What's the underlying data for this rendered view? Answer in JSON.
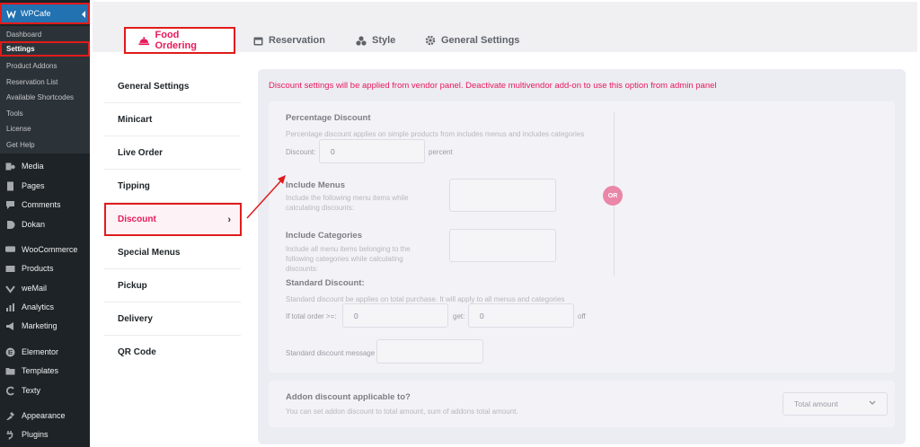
{
  "sidebar": {
    "top_item": {
      "label": "WPCafe",
      "icon": "wpcafe-logo-icon"
    },
    "submenu": [
      "Dashboard",
      "Settings",
      "Product Addons",
      "Reservation List",
      "Available Shortcodes",
      "Tools",
      "License",
      "Get Help"
    ],
    "active_submenu": "Settings",
    "menu": [
      {
        "label": "Media",
        "icon": "media-icon"
      },
      {
        "label": "Pages",
        "icon": "pages-icon"
      },
      {
        "label": "Comments",
        "icon": "comments-icon"
      },
      {
        "label": "Dokan",
        "icon": "dokan-icon"
      },
      {
        "label": "WooCommerce",
        "icon": "woocommerce-icon"
      },
      {
        "label": "Products",
        "icon": "products-icon"
      },
      {
        "label": "weMail",
        "icon": "wemail-icon"
      },
      {
        "label": "Analytics",
        "icon": "analytics-icon"
      },
      {
        "label": "Marketing",
        "icon": "marketing-icon"
      },
      {
        "label": "Elementor",
        "icon": "elementor-icon"
      },
      {
        "label": "Templates",
        "icon": "templates-icon"
      },
      {
        "label": "Texty",
        "icon": "texty-icon"
      },
      {
        "label": "Appearance",
        "icon": "appearance-icon"
      },
      {
        "label": "Plugins",
        "icon": "plugins-icon"
      }
    ]
  },
  "tabs": [
    {
      "label": "Food Ordering",
      "icon": "food-cloche-icon",
      "active": true
    },
    {
      "label": "Reservation",
      "icon": "calendar-icon"
    },
    {
      "label": "Style",
      "icon": "style-icon"
    },
    {
      "label": "General Settings",
      "icon": "gear-icon"
    }
  ],
  "left_nav": [
    "General Settings",
    "Minicart",
    "Live Order",
    "Tipping",
    "Discount",
    "Special Menus",
    "Pickup",
    "Delivery",
    "QR Code"
  ],
  "left_nav_active": "Discount",
  "notice": "Discount settings will be applied from vendor panel. Deactivate multivendor add-on to use this option from admin panel",
  "percentage_discount": {
    "title": "Percentage Discount",
    "description": "Percentage discount applies on simple products from includes menus and includes categories",
    "field_label": "Discount:",
    "value": "0",
    "unit": "percent"
  },
  "include_menus": {
    "title": "Include Menus",
    "description": "Include the following menu items while calculating discounts:"
  },
  "include_categories": {
    "title": "Include Categories",
    "description": "Include all menu items belonging to the following categories while calculating discounts:"
  },
  "or_label": "OR",
  "standard_discount": {
    "title": "Standard Discount:",
    "description": "Standard discount be applies on total purchase. It will apply to all menus and categories",
    "if_total_label": "If total order >=:",
    "total_value": "0",
    "get_label": "get:",
    "get_value": "0",
    "off_label": "off",
    "message_label": "Standard discount message",
    "message_value": ""
  },
  "addon_discount": {
    "title": "Addon discount applicable to?",
    "description": "You can set addon discount to total amount, sum of addons total amount.",
    "selected": "Total amount"
  },
  "colors": {
    "accent": "#e81a5a",
    "highlight_border": "#e01b1b",
    "wp_admin_bg": "#1d2327",
    "wp_active": "#2271b1"
  }
}
